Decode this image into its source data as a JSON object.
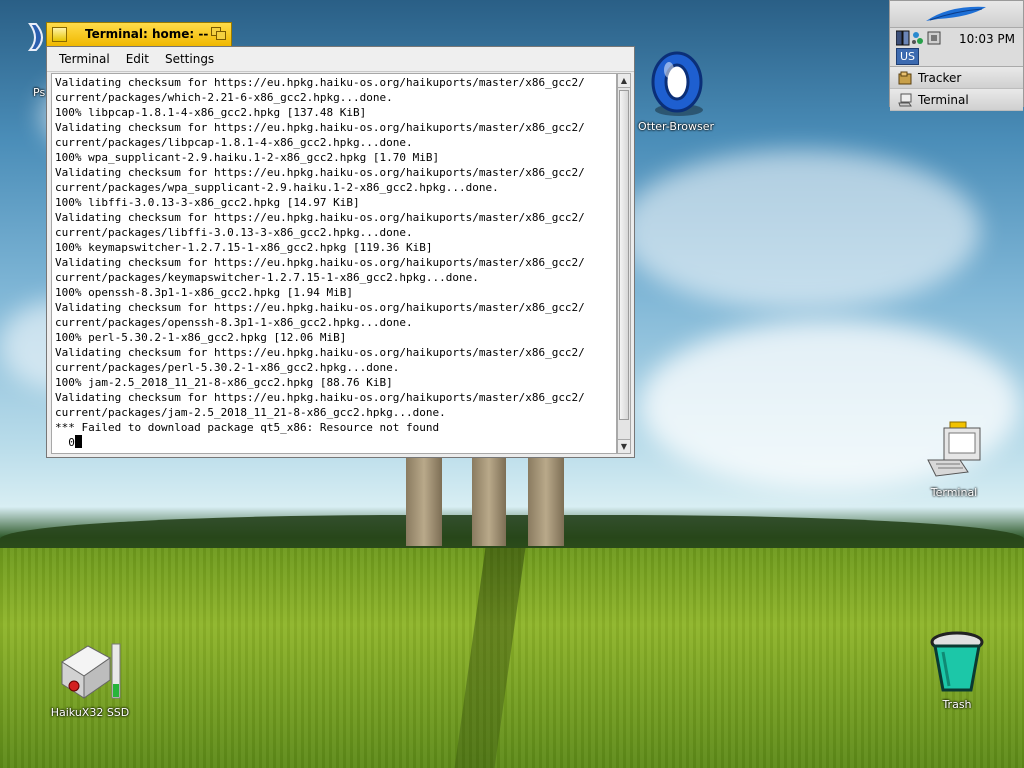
{
  "desktop": {
    "icons": [
      {
        "label": "Ps"
      },
      {
        "label": "Otter-Browser"
      },
      {
        "label": "Terminal"
      },
      {
        "label": "HaikuX32 SSD"
      },
      {
        "label": "Trash"
      }
    ]
  },
  "deskbar": {
    "clock": "10:03 PM",
    "keymap": "US",
    "apps": [
      {
        "label": "Tracker",
        "icon": "tracker-icon"
      },
      {
        "label": "Terminal",
        "icon": "terminal-icon"
      }
    ]
  },
  "terminal": {
    "title": "Terminal: home: --",
    "menu": [
      "Terminal",
      "Edit",
      "Settings"
    ],
    "lines": [
      "Validating checksum for https://eu.hpkg.haiku-os.org/haikuports/master/x86_gcc2/",
      "current/packages/which-2.21-6-x86_gcc2.hpkg...done.",
      "100% libpcap-1.8.1-4-x86_gcc2.hpkg [137.48 KiB]",
      "Validating checksum for https://eu.hpkg.haiku-os.org/haikuports/master/x86_gcc2/",
      "current/packages/libpcap-1.8.1-4-x86_gcc2.hpkg...done.",
      "100% wpa_supplicant-2.9.haiku.1-2-x86_gcc2.hpkg [1.70 MiB]",
      "Validating checksum for https://eu.hpkg.haiku-os.org/haikuports/master/x86_gcc2/",
      "current/packages/wpa_supplicant-2.9.haiku.1-2-x86_gcc2.hpkg...done.",
      "100% libffi-3.0.13-3-x86_gcc2.hpkg [14.97 KiB]",
      "Validating checksum for https://eu.hpkg.haiku-os.org/haikuports/master/x86_gcc2/",
      "current/packages/libffi-3.0.13-3-x86_gcc2.hpkg...done.",
      "100% keymapswitcher-1.2.7.15-1-x86_gcc2.hpkg [119.36 KiB]",
      "Validating checksum for https://eu.hpkg.haiku-os.org/haikuports/master/x86_gcc2/",
      "current/packages/keymapswitcher-1.2.7.15-1-x86_gcc2.hpkg...done.",
      "100% openssh-8.3p1-1-x86_gcc2.hpkg [1.94 MiB]",
      "Validating checksum for https://eu.hpkg.haiku-os.org/haikuports/master/x86_gcc2/",
      "current/packages/openssh-8.3p1-1-x86_gcc2.hpkg...done.",
      "100% perl-5.30.2-1-x86_gcc2.hpkg [12.06 MiB]",
      "Validating checksum for https://eu.hpkg.haiku-os.org/haikuports/master/x86_gcc2/",
      "current/packages/perl-5.30.2-1-x86_gcc2.hpkg...done.",
      "100% jam-2.5_2018_11_21-8-x86_gcc2.hpkg [88.76 KiB]",
      "Validating checksum for https://eu.hpkg.haiku-os.org/haikuports/master/x86_gcc2/",
      "current/packages/jam-2.5_2018_11_21-8-x86_gcc2.hpkg...done.",
      "*** Failed to download package qt5_x86: Resource not found"
    ],
    "prompt": "  0"
  }
}
